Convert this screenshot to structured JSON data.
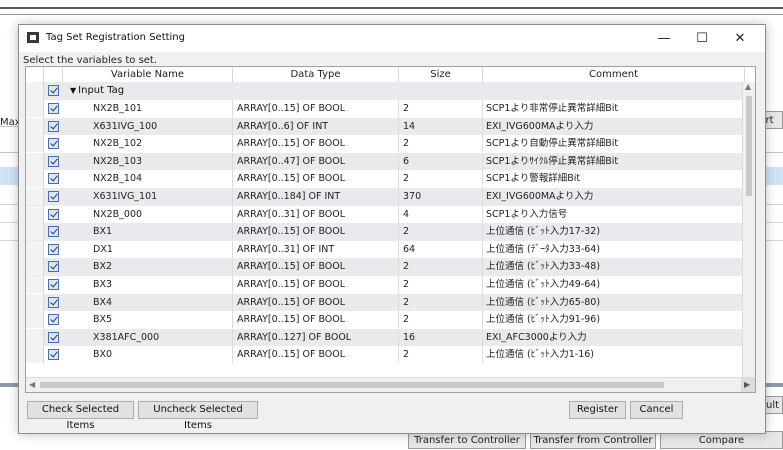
{
  "background": {
    "side_label_left": "Max:",
    "side_button_right_top": "rt",
    "side_button_right_bottom": "ault",
    "buttons": [
      "Transfer to Controller",
      "Transfer from Controller",
      "Compare"
    ]
  },
  "dialog": {
    "title": "Tag Set Registration Setting",
    "window_controls": {
      "minimize": "—",
      "maximize": "☐",
      "close": "✕"
    },
    "prompt": "Select the variables to set.",
    "columns": [
      "Variable Name",
      "Data Type",
      "Size",
      "Comment"
    ],
    "group": {
      "label": "Input Tag",
      "expanded_glyph": "▼"
    },
    "rows": [
      {
        "name": "NX2B_101",
        "type": "ARRAY[0..15] OF BOOL",
        "size": "2",
        "comment": "SCP1より非常停止異常詳細Bit"
      },
      {
        "name": "X631IVG_100",
        "type": "ARRAY[0..6] OF INT",
        "size": "14",
        "comment": "EXI_IVG600MAより入力"
      },
      {
        "name": "NX2B_102",
        "type": "ARRAY[0..15] OF BOOL",
        "size": "2",
        "comment": "SCP1より自動停止異常詳細Bit"
      },
      {
        "name": "NX2B_103",
        "type": "ARRAY[0..47] OF BOOL",
        "size": "6",
        "comment": "SCP1よりｻｲｸﾙ停止異常詳細Bit"
      },
      {
        "name": "NX2B_104",
        "type": "ARRAY[0..15] OF BOOL",
        "size": "2",
        "comment": "SCP1より警報詳細Bit"
      },
      {
        "name": "X631IVG_101",
        "type": "ARRAY[0..184] OF INT",
        "size": "370",
        "comment": "EXI_IVG600MAより入力"
      },
      {
        "name": "NX2B_000",
        "type": "ARRAY[0..31] OF BOOL",
        "size": "4",
        "comment": "SCP1より入力信号"
      },
      {
        "name": "BX1",
        "type": "ARRAY[0..15] OF BOOL",
        "size": "2",
        "comment": "上位通信 (ﾋﾞｯﾄ入力17-32)"
      },
      {
        "name": "DX1",
        "type": "ARRAY[0..31] OF INT",
        "size": "64",
        "comment": "上位通信 (ﾃﾞｰﾀ入力33-64)"
      },
      {
        "name": "BX2",
        "type": "ARRAY[0..15] OF BOOL",
        "size": "2",
        "comment": "上位通信 (ﾋﾞｯﾄ入力33-48)"
      },
      {
        "name": "BX3",
        "type": "ARRAY[0..15] OF BOOL",
        "size": "2",
        "comment": "上位通信 (ﾋﾞｯﾄ入力49-64)"
      },
      {
        "name": "BX4",
        "type": "ARRAY[0..15] OF BOOL",
        "size": "2",
        "comment": "上位通信 (ﾋﾞｯﾄ入力65-80)"
      },
      {
        "name": "BX5",
        "type": "ARRAY[0..15] OF BOOL",
        "size": "2",
        "comment": "上位通信 (ﾋﾞｯﾄ入力91-96)"
      },
      {
        "name": "X381AFC_000",
        "type": "ARRAY[0..127] OF BOOL",
        "size": "16",
        "comment": "EXI_AFC3000より入力"
      },
      {
        "name": "BX0",
        "type": "ARRAY[0..15] OF BOOL",
        "size": "2",
        "comment": "上位通信 (ﾋﾞｯﾄ入力1-16)"
      }
    ],
    "buttons": {
      "check_selected": "Check Selected Items",
      "uncheck_selected": "Uncheck Selected Items",
      "register": "Register",
      "cancel": "Cancel"
    }
  }
}
